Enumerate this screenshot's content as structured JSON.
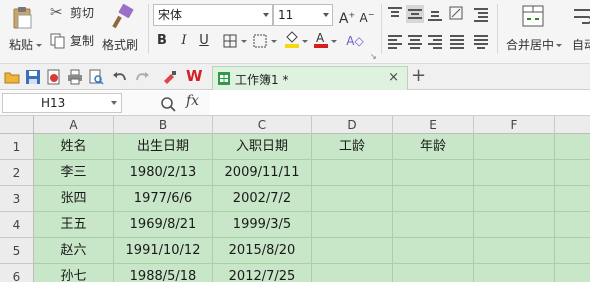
{
  "ribbon": {
    "paste_label": "粘贴",
    "cut_label": "剪切",
    "copy_label": "复制",
    "format_painter_label": "格式刷",
    "font_name": "宋体",
    "font_size": "11",
    "bold": "B",
    "italic": "I",
    "underline": "U",
    "merge_center_label": "合并居中",
    "auto_wrap_label": "自动"
  },
  "tabs": {
    "active_tab": "工作簿1 *",
    "close_glyph": "×",
    "new_tab_glyph": "+"
  },
  "formula_bar": {
    "name_box": "H13",
    "fx_label": "fx",
    "formula": ""
  },
  "grid": {
    "columns": [
      "A",
      "B",
      "C",
      "D",
      "E",
      "F",
      ""
    ],
    "row_numbers": [
      "1",
      "2",
      "3",
      "4",
      "5",
      "6"
    ],
    "rows": [
      [
        "姓名",
        "出生日期",
        "入职日期",
        "工龄",
        "年龄",
        "",
        ""
      ],
      [
        "李三",
        "1980/2/13",
        "2009/11/11",
        "",
        "",
        "",
        ""
      ],
      [
        "张四",
        "1977/6/6",
        "2002/7/2",
        "",
        "",
        "",
        ""
      ],
      [
        "王五",
        "1969/8/21",
        "1999/3/5",
        "",
        "",
        "",
        ""
      ],
      [
        "赵六",
        "1991/10/12",
        "2015/8/20",
        "",
        "",
        "",
        ""
      ],
      [
        "孙七",
        "1988/5/18",
        "2012/7/25",
        "",
        "",
        "",
        ""
      ]
    ]
  },
  "colors": {
    "sheet_background": "#c8e6c8",
    "grid_line": "#a9cfa9",
    "font_color_red": "#d42020",
    "highlight_yellow": "#f5d80f"
  }
}
